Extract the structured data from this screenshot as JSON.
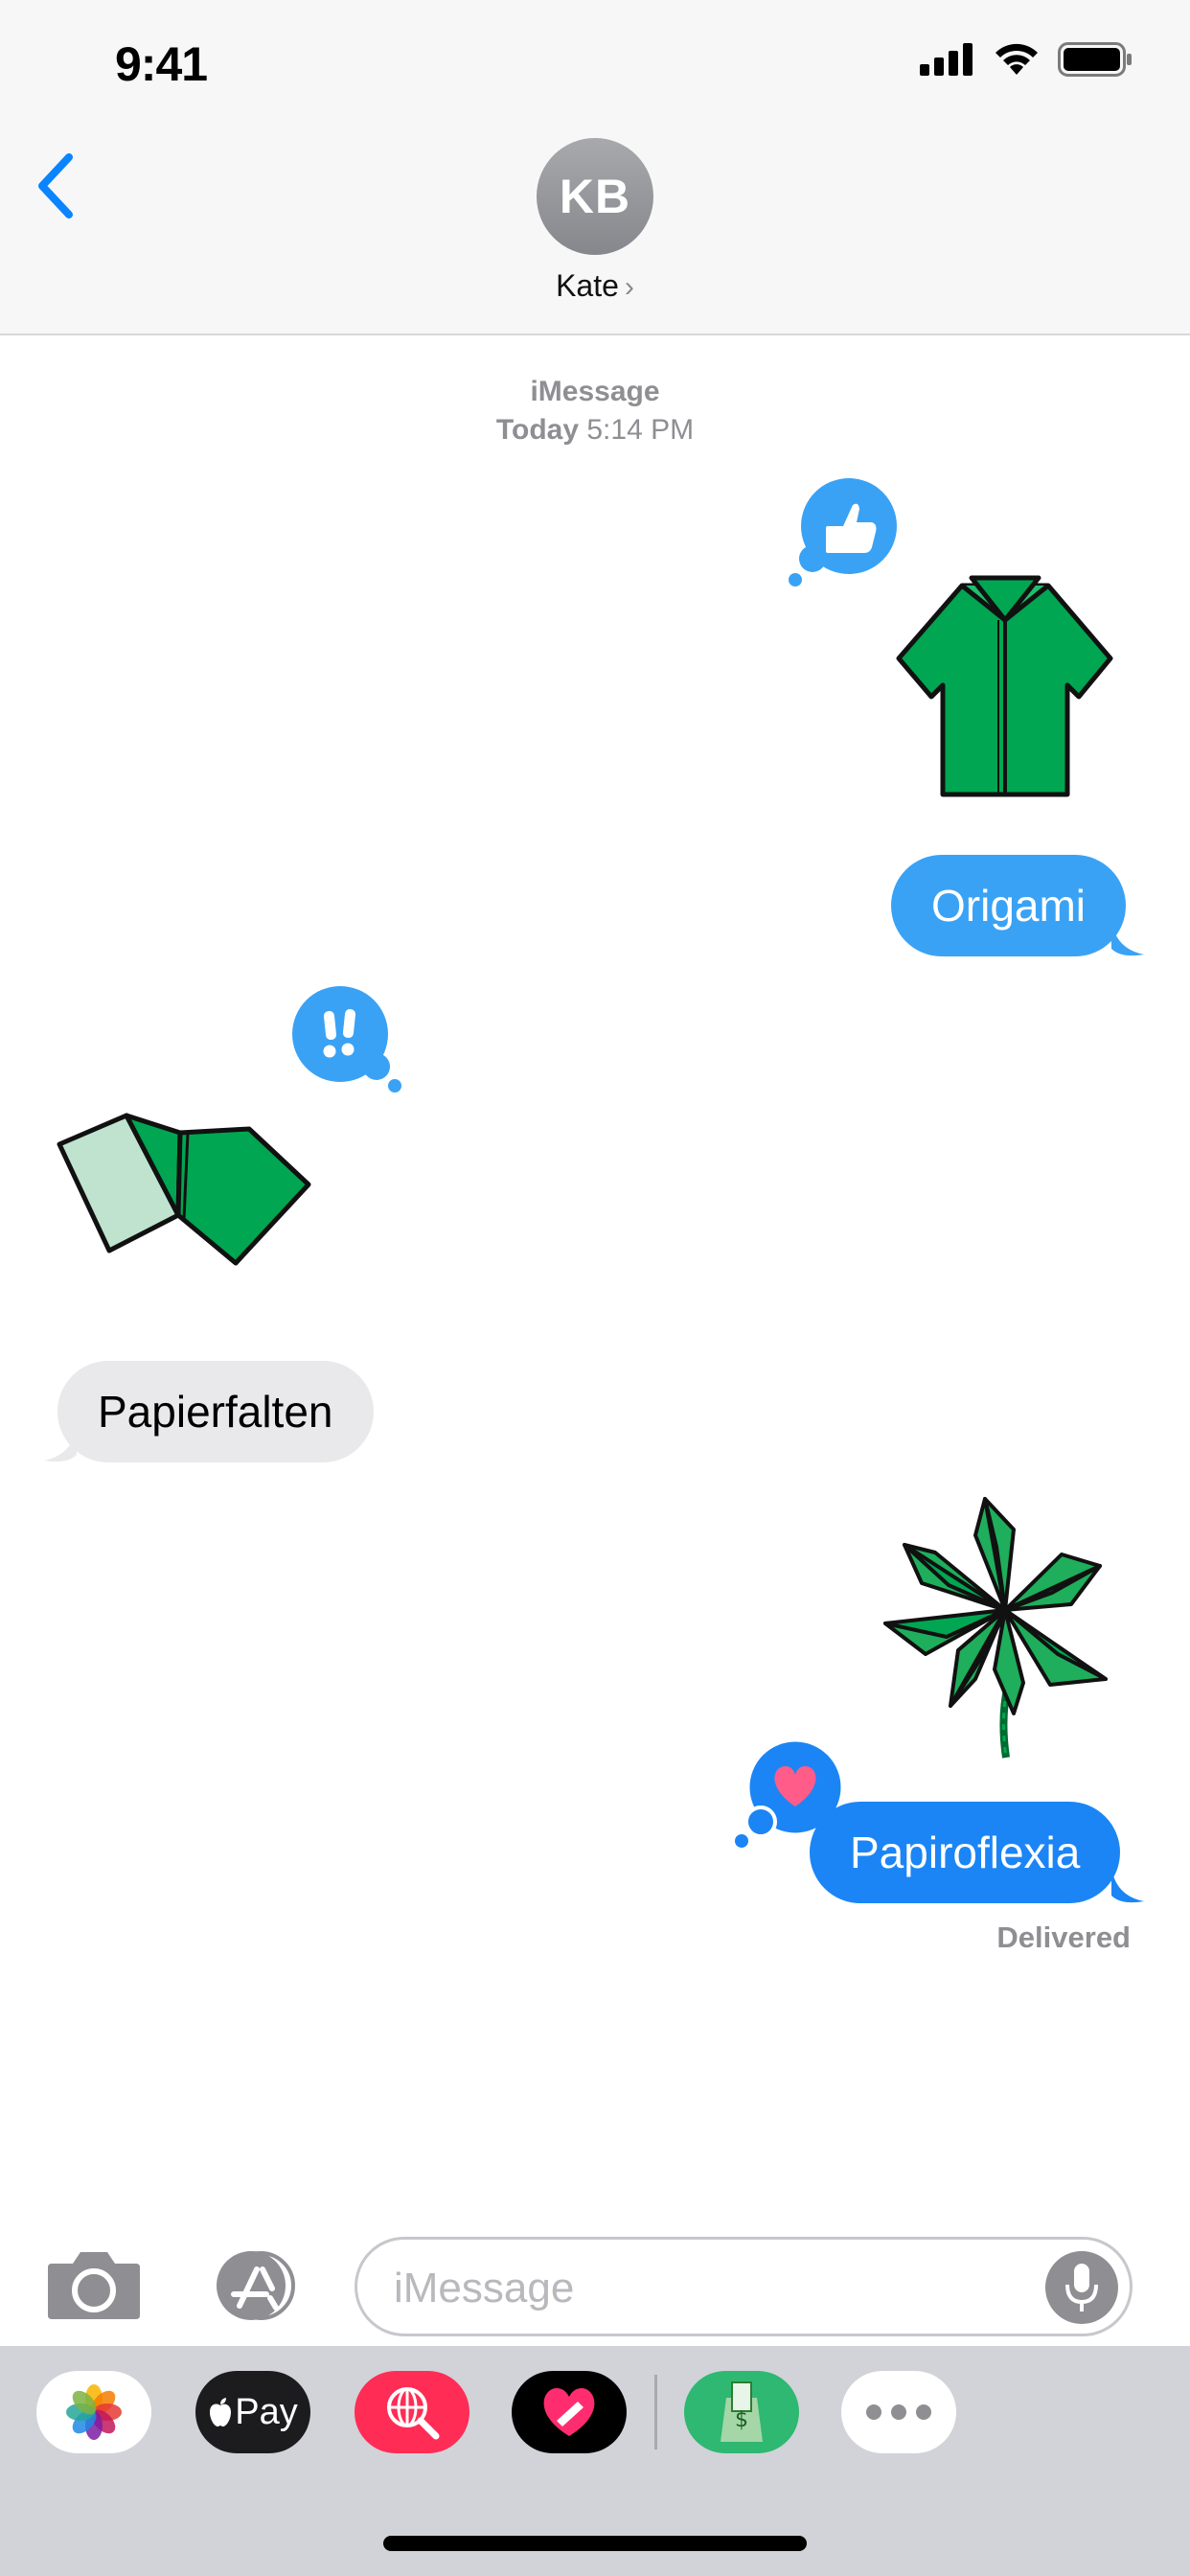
{
  "status_bar": {
    "time": "9:41"
  },
  "header": {
    "avatar_initials": "KB",
    "contact_name": "Kate",
    "chevron": "›"
  },
  "thread": {
    "service": "iMessage",
    "day": "Today",
    "time": "5:14 PM",
    "messages": [
      {
        "direction": "outgoing",
        "type": "sticker",
        "sticker": "origami-shirt",
        "tapback": "thumbs-up"
      },
      {
        "direction": "outgoing",
        "type": "text",
        "text": "Origami"
      },
      {
        "direction": "incoming",
        "type": "sticker",
        "sticker": "origami-folded-paper",
        "tapback": "exclamation"
      },
      {
        "direction": "incoming",
        "type": "text",
        "text": "Papierfalten"
      },
      {
        "direction": "outgoing",
        "type": "sticker",
        "sticker": "origami-palm-tree"
      },
      {
        "direction": "outgoing",
        "type": "text",
        "text": "Papiroflexia",
        "tapback": "heart"
      }
    ],
    "status": "Delivered"
  },
  "compose": {
    "placeholder": "iMessage"
  },
  "app_drawer": {
    "apple_pay_label": "Pay",
    "apps": [
      "photos-app",
      "apple-pay-app",
      "web-images-search-app",
      "digital-touch-app",
      "money-stickers-app",
      "more-apps"
    ]
  },
  "colors": {
    "outgoing_bubble": "#1b85f6",
    "incoming_bubble": "#e9e9eb",
    "tapback_blue": "#3aa2f5",
    "origami_green": "#00a651",
    "ios_blue": "#0a84ff",
    "gray_text": "#8e8e93"
  }
}
